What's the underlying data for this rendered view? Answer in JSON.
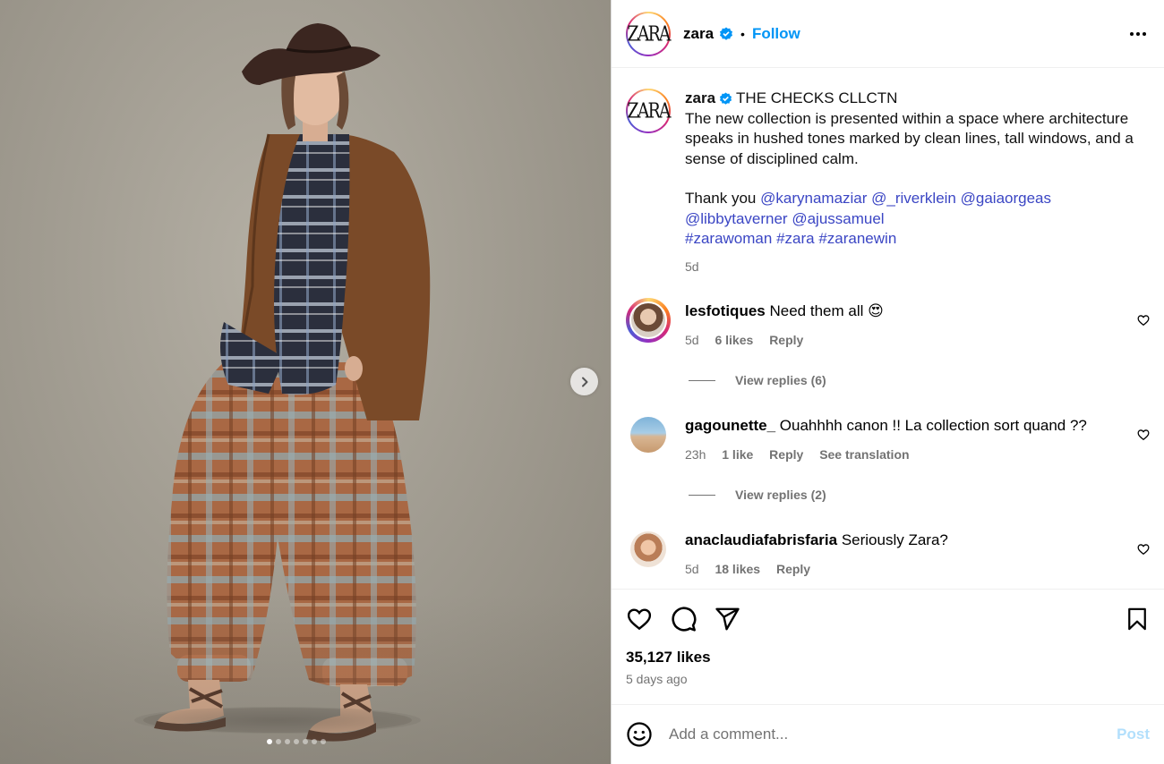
{
  "post": {
    "username": "zara",
    "follow_label": "Follow",
    "separator": "•",
    "caption_title": "THE CHECKS CLLCTN",
    "caption_text": "The new collection is presented within a space where architecture speaks in hushed tones marked by clean lines, tall windows, and a sense of disciplined calm.",
    "thanks_prefix": "Thank you",
    "mentions": [
      "@karynamaziar",
      "@_riverklein",
      "@gaiaorgeas",
      "@libbytaverner",
      "@ajussamuel"
    ],
    "hashtags": [
      "#zarawoman",
      "#zara",
      "#zaranewin"
    ],
    "caption_age": "5d",
    "likes": "35,127 likes",
    "posted_ago": "5 days ago",
    "carousel": {
      "count": 7,
      "active_index": 0
    }
  },
  "comments": [
    {
      "username": "lesfotiques",
      "text": "Need them all",
      "emoji": "😍",
      "age": "5d",
      "likes": "6 likes",
      "reply": "Reply",
      "view_replies": "View replies (6)"
    },
    {
      "username": "gagounette_",
      "text": "Ouahhhh canon !! La collection sort quand ??",
      "age": "23h",
      "likes": "1 like",
      "reply": "Reply",
      "translate": "See translation",
      "view_replies": "View replies (2)"
    },
    {
      "username": "anaclaudiafabrisfaria",
      "text": "Seriously Zara?",
      "age": "5d",
      "likes": "18 likes",
      "reply": "Reply"
    }
  ],
  "composer": {
    "placeholder": "Add a comment...",
    "post_label": "Post"
  },
  "logo_text": "ZARA",
  "colors": {
    "accent": "#0095f6",
    "link": "#3b46c4",
    "muted": "#737373",
    "post_disabled": "#b2dffc"
  },
  "icons": [
    "verified-icon",
    "more-icon",
    "heart-icon",
    "comment-icon",
    "share-icon",
    "bookmark-icon",
    "emoji-icon",
    "chevron-right-icon"
  ]
}
